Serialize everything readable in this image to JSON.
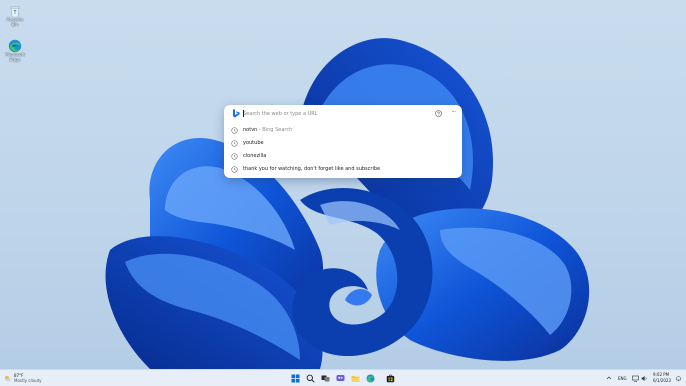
{
  "desktop": {
    "icons": [
      {
        "name": "recycle-bin",
        "label": "Recycle Bin"
      },
      {
        "name": "microsoft-edge",
        "label": "Microsoft Edge"
      }
    ]
  },
  "popup": {
    "search_placeholder": "Search the web or type a URL",
    "help_icon": "help-icon",
    "more_icon": "more-icon",
    "suggestions": [
      {
        "text": "notvn",
        "hint": " - Bing Search"
      },
      {
        "text": "youtube",
        "hint": ""
      },
      {
        "text": "clonezilla",
        "hint": ""
      },
      {
        "text": "thank you for watching, don't forget like and subscribe",
        "hint": ""
      }
    ]
  },
  "taskbar": {
    "weather": {
      "temp": "87°F",
      "condition": "Mostly cloudy"
    },
    "icons": [
      "windows-start-icon",
      "search-icon",
      "task-view-icon",
      "chat-icon",
      "file-explorer-icon",
      "edge-icon",
      "store-icon"
    ],
    "tray": {
      "language": "ENG",
      "time": "9:02 PM",
      "date": "6/1/2023"
    }
  },
  "colors": {
    "accent": "#0a5bd8",
    "wallpaper_bg": "#c5d9ed",
    "taskbar_bg": "#e7eef7"
  }
}
